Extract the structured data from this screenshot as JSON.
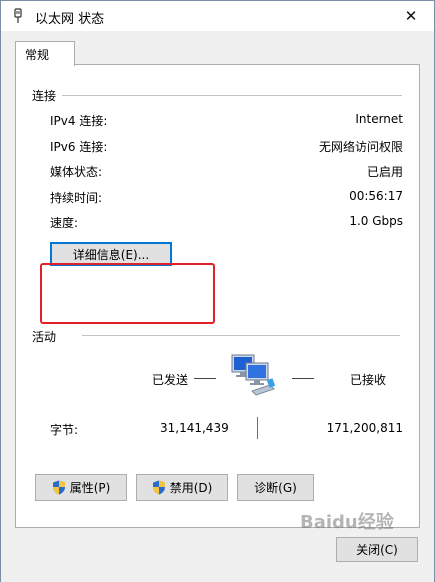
{
  "window": {
    "title": "以太网 状态",
    "close_glyph": "✕"
  },
  "tabs": [
    {
      "label": "常规"
    }
  ],
  "connection": {
    "group_label": "连接",
    "rows": [
      {
        "label": "IPv4 连接:",
        "value": "Internet"
      },
      {
        "label": "IPv6 连接:",
        "value": "无网络访问权限"
      },
      {
        "label": "媒体状态:",
        "value": "已启用"
      },
      {
        "label": "持续时间:",
        "value": "00:56:17"
      },
      {
        "label": "速度:",
        "value": "1.0 Gbps"
      }
    ],
    "details_button": "详细信息(E)..."
  },
  "activity": {
    "group_label": "活动",
    "sent_label": "已发送",
    "received_label": "已接收",
    "bytes_label": "字节:",
    "bytes_sent": "31,141,439",
    "bytes_received": "171,200,811"
  },
  "buttons": {
    "properties": "属性(P)",
    "disable": "禁用(D)",
    "diagnose": "诊断(G)",
    "close": "关闭(C)"
  },
  "watermark": "Baidu经验",
  "colors": {
    "highlight": "#e3202a",
    "focus": "#0078d7",
    "shield_blue": "#2a6cc9",
    "shield_yellow": "#f4c542"
  },
  "icons": [
    "ethernet-icon",
    "close-icon",
    "network-computers-icon",
    "uac-shield-icon"
  ]
}
